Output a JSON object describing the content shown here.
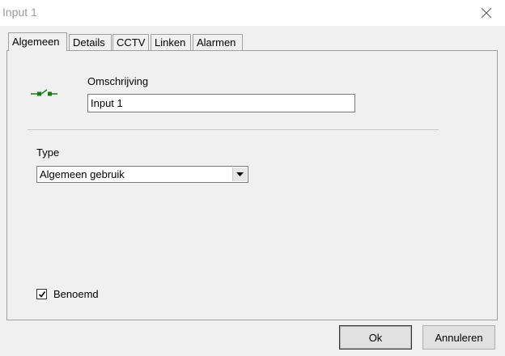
{
  "window": {
    "title": "Input 1"
  },
  "tabs": [
    {
      "label": "Algemeen",
      "active": true
    },
    {
      "label": "Details"
    },
    {
      "label": "CCTV"
    },
    {
      "label": "Linken"
    },
    {
      "label": "Alarmen"
    }
  ],
  "general": {
    "icon": "input-switch-icon",
    "description_label": "Omschrijving",
    "description_value": "Input 1",
    "type_label": "Type",
    "type_value": "Algemeen gebruik",
    "named_label": "Benoemd",
    "named_checked": true
  },
  "buttons": {
    "ok": "Ok",
    "cancel": "Annuleren"
  },
  "colors": {
    "switch_icon": "#1a7a1a"
  }
}
